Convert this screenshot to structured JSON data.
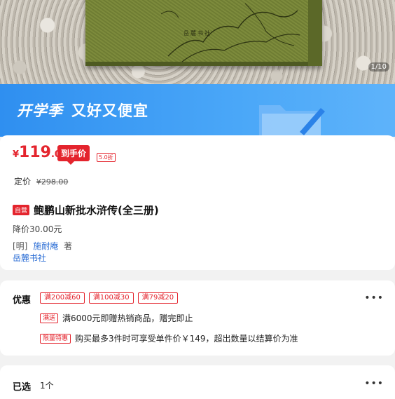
{
  "hero": {
    "image_counter": "1/10",
    "seal_text": "岳麓书社"
  },
  "banner": {
    "title": "开学季",
    "subtitle": "又好又便宜"
  },
  "price": {
    "currency": "¥",
    "integer": "119",
    "decimal": ".00",
    "final_tag": "到手价",
    "discount": "5.0折",
    "list_label": "定价",
    "list_price": "¥298.00"
  },
  "product": {
    "badge": "自营",
    "title": "鲍鹏山新批水浒传(全三册)",
    "drop_price": "降价30.00元",
    "dynasty": "[明]",
    "author": "施耐庵",
    "author_suffix": "著",
    "publisher": "岳麓书社"
  },
  "offers": {
    "label": "优惠",
    "coupons": [
      "满200减60",
      "满100减30",
      "满79减20"
    ],
    "promos": [
      {
        "tag": "满送",
        "text": "满6000元即赠热销商品，赠完即止"
      },
      {
        "tag": "限量特惠",
        "text": "购买最多3件时可享受单件价￥149，超出数量以结算价为准"
      }
    ],
    "more": "•••"
  },
  "selected": {
    "label": "已选",
    "value": "1个",
    "more": "•••"
  },
  "colors": {
    "accent_red": "#e4242d",
    "link_blue": "#2c6ed5",
    "banner_blue": "#2f8ff0",
    "cover_green": "#7d8b3c"
  }
}
